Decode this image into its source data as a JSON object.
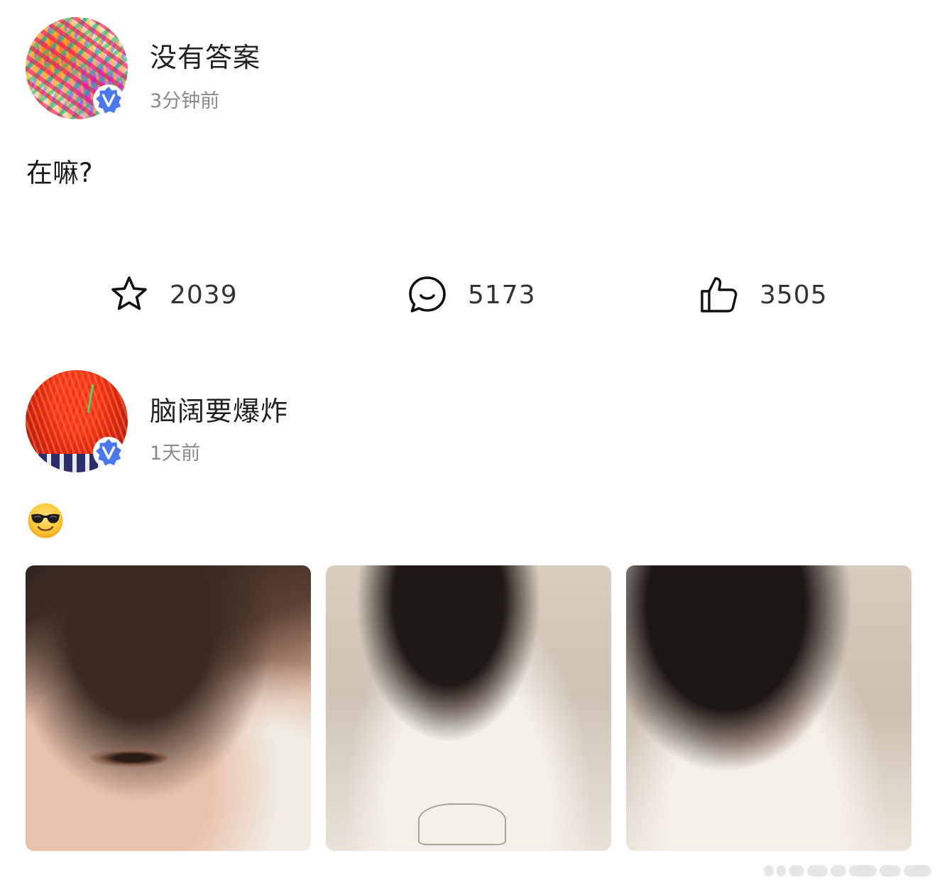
{
  "posts": [
    {
      "username": "没有答案",
      "timestamp": "3分钟前",
      "text": "在嘛?",
      "actions": {
        "favorite_count": "2039",
        "comment_count": "5173",
        "like_count": "3505"
      },
      "verified": true
    },
    {
      "username": "脑阔要爆炸",
      "timestamp": "1天前",
      "text_emoji": "sunglasses-emoji",
      "photos": [
        "photo-1",
        "photo-2",
        "photo-3"
      ],
      "verified": true
    }
  ],
  "colors": {
    "verified_badge": "#4a78ee",
    "text_primary": "#1a1a1a",
    "text_secondary": "#8a8a8a"
  }
}
